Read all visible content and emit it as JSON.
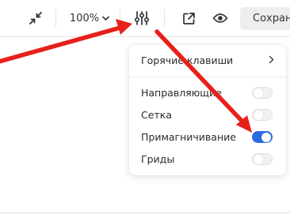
{
  "toolbar": {
    "zoom_label": "100%",
    "save_label": "Сохранить",
    "icons": [
      "collapse-icon",
      "chevron-down-icon",
      "settings-sliders-icon",
      "external-link-icon",
      "eye-icon"
    ]
  },
  "menu": {
    "hotkeys": {
      "label": "Горячие клавиши",
      "icon": "chevron-right-icon"
    },
    "toggles": [
      {
        "label": "Направляющие",
        "on": false
      },
      {
        "label": "Сетка",
        "on": false
      },
      {
        "label": "Примагничивание",
        "on": true
      },
      {
        "label": "Гриды",
        "on": false
      }
    ]
  },
  "colors": {
    "accent": "#2c6bde",
    "annotation_arrow": "#e8201a"
  }
}
